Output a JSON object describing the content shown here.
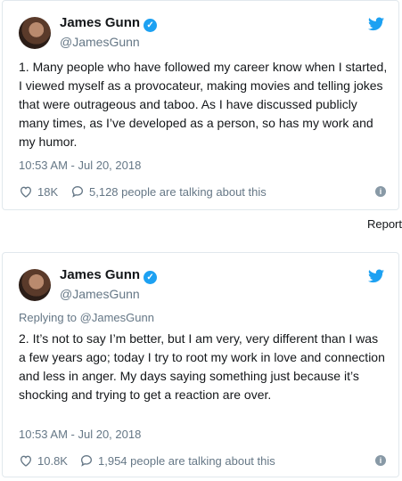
{
  "tweets": [
    {
      "name": "James Gunn",
      "handle": "@JamesGunn",
      "reply_to": "",
      "text": "1. Many people who have followed my career know when I started, I viewed myself as a provocateur, making movies and telling jokes that were outrageous and taboo. As I have discussed publicly many times, as I’ve developed as a person, so has my work and my humor.",
      "timestamp": "10:53 AM - Jul 20, 2018",
      "likes": "18K",
      "talking": "5,128 people are talking about this"
    },
    {
      "name": "James Gunn",
      "handle": "@JamesGunn",
      "reply_to": "Replying to @JamesGunn",
      "text": "2. It’s not to say I’m better, but I am very, very different than I was a few years ago; today I try to root my work in love and connection and less in anger.  My days saying something just because it’s shocking and trying to get a reaction are over.",
      "timestamp": "10:53 AM - Jul 20, 2018",
      "likes": "10.8K",
      "talking": "1,954 people are talking about this"
    }
  ],
  "report_label": "Report",
  "icons": {
    "verified": "verified-badge-icon",
    "bird": "twitter-bird-icon",
    "like": "heart-icon",
    "reply": "comment-bubble-icon",
    "info": "info-icon"
  },
  "colors": {
    "accent": "#1da1f2",
    "muted": "#657786",
    "border": "#e1e8ed",
    "text": "#14171a"
  }
}
